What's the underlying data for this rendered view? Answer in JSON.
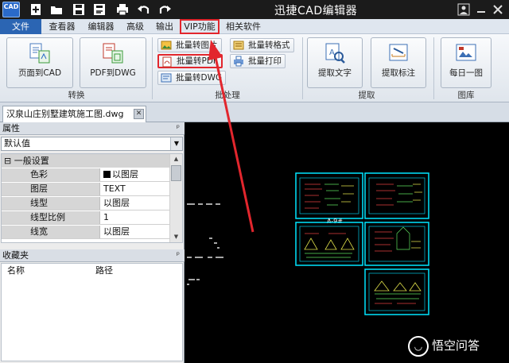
{
  "app": {
    "title": "迅捷CAD编辑器",
    "logo_text": "CAD"
  },
  "quick_access": [
    "new-icon",
    "open-icon",
    "save-icon",
    "save-as-icon",
    "print-icon",
    "undo-icon",
    "redo-icon"
  ],
  "window_controls": [
    "account-icon",
    "minimize-icon",
    "close-icon"
  ],
  "menu": {
    "items": [
      "文件",
      "查看器",
      "编辑器",
      "高级",
      "输出",
      "VIP功能",
      "相关软件"
    ],
    "active": "VIP功能"
  },
  "ribbon": {
    "groups": [
      {
        "label": "转换",
        "buttons": [
          "页面到CAD",
          "PDF到DWG"
        ]
      },
      {
        "label": "批处理",
        "buttons": [
          "批量转图片",
          "批量转格式",
          "批量转PDF",
          "批量打印",
          "批量转DWG"
        ]
      },
      {
        "label": "提取",
        "buttons": [
          "提取文字",
          "提取标注"
        ]
      },
      {
        "label": "图库",
        "buttons": [
          "每日一图"
        ]
      }
    ]
  },
  "document_tab": {
    "name": "汉泉山庄别墅建筑施工图.dwg",
    "close": "✕"
  },
  "properties_panel": {
    "title": "属性",
    "pin": "ᵖ",
    "selector_value": "默认值",
    "category": "一般设置",
    "rows": [
      {
        "key": "色彩",
        "value": "以图层",
        "swatch": true
      },
      {
        "key": "图层",
        "value": "TEXT"
      },
      {
        "key": "线型",
        "value": "以图层"
      },
      {
        "key": "线型比例",
        "value": "1"
      },
      {
        "key": "线宽",
        "value": "以图层"
      }
    ]
  },
  "favorites_panel": {
    "title": "收藏夹",
    "pin": "ᵖ",
    "columns": [
      "名称",
      "路径"
    ]
  },
  "canvas": {
    "sheet_label": "A-9#"
  },
  "watermark": {
    "text": "悟空问答"
  },
  "colors": {
    "accent_blue": "#2b65b3",
    "highlight_red": "#e2262d",
    "cad_cyan": "#00e5ff",
    "cad_bg": "#000000"
  }
}
